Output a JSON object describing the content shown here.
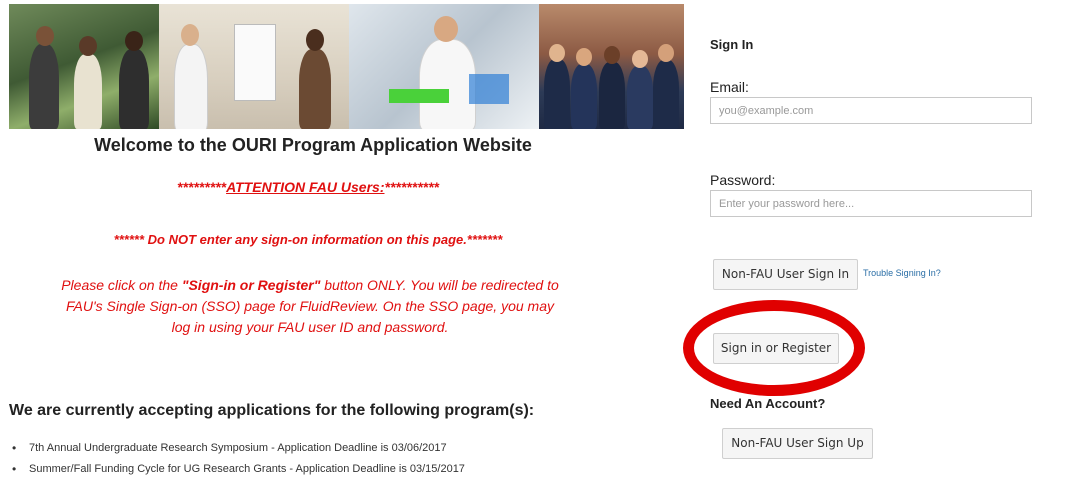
{
  "banner": {
    "alt": "OURI students photo collage"
  },
  "welcome": "Welcome to the OURI Program Application Website",
  "attention": {
    "prefix": "*********",
    "link": "ATTENTION FAU Users:",
    "suffix": "**********"
  },
  "do_not": "****** Do NOT enter any sign-on information on this page.*******",
  "instructions": {
    "part1": "Please click on the ",
    "emph": "\"Sign-in or Register\"",
    "part2": " button ONLY.  You will be redirected to FAU's Single Sign-on (SSO) page for FluidReview.  On the SSO page, you may log in using your FAU user ID and password."
  },
  "accepting_heading": "We are currently accepting applications for the following program(s):",
  "programs": [
    "7th Annual Undergraduate Research Symposium - Application Deadline is 03/06/2017",
    "Summer/Fall Funding Cycle for UG Research Grants - Application Deadline is 03/15/2017"
  ],
  "signin": {
    "title": "Sign In",
    "email_label": "Email:",
    "email_placeholder": "you@example.com",
    "password_label": "Password:",
    "password_placeholder": "Enter your password here...",
    "nonfau_signin_label": "Non-FAU User Sign In",
    "trouble_label": "Trouble Signing In?",
    "signin_register_label": "Sign in or Register",
    "need_account": "Need An Account?",
    "nonfau_signup_label": "Non-FAU User Sign Up"
  },
  "colors": {
    "attention_red": "#e01010",
    "highlight_ring": "#e00000",
    "link_blue": "#2a6ea6"
  }
}
